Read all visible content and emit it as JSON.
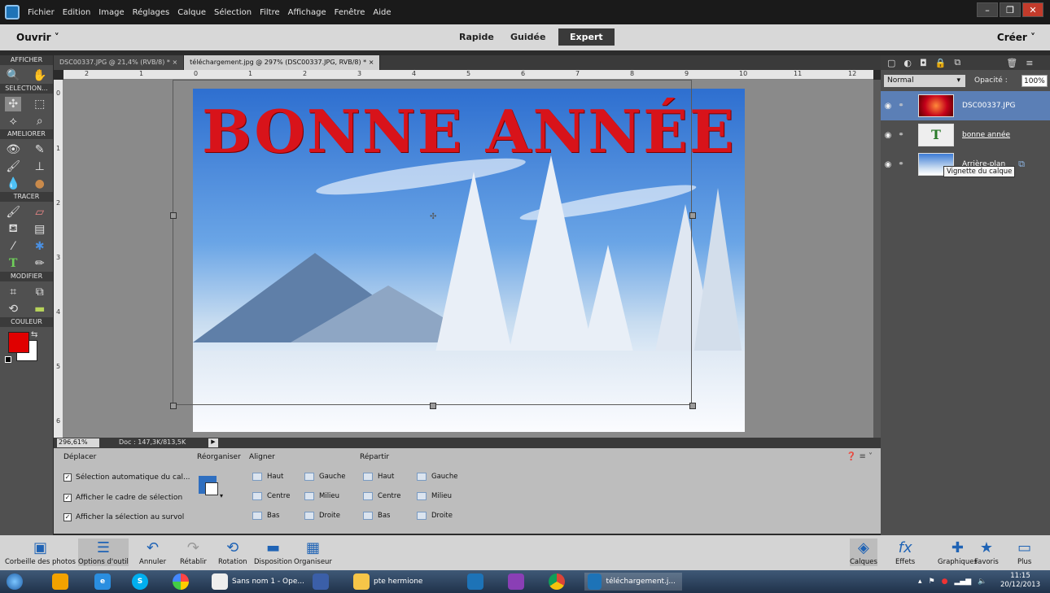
{
  "menubar": {
    "items": [
      "Fichier",
      "Edition",
      "Image",
      "Réglages",
      "Calque",
      "Sélection",
      "Filtre",
      "Affichage",
      "Fenêtre",
      "Aide"
    ],
    "window_buttons": [
      "–",
      "❐",
      "✕"
    ]
  },
  "modebar": {
    "open_label": "Ouvrir",
    "modes": [
      "Rapide",
      "Guidée",
      "Expert"
    ],
    "active_mode": "Expert",
    "create_label": "Créer"
  },
  "toolbox": {
    "sections": [
      "AFFICHER",
      "SELECTION...",
      "AMELIORER",
      "TRACER",
      "MODIFIER",
      "COULEUR"
    ],
    "foreground_color": "#e00000",
    "background_color": "#ffffff"
  },
  "doc_tabs": [
    {
      "label": "DSC00337.JPG @ 21,4% (RVB/8) *"
    },
    {
      "label": "téléchargement.jpg @ 297% (DSC00337.JPG, RVB/8) *"
    }
  ],
  "ruler": {
    "h_marks": [
      "2",
      "1",
      "0",
      "1",
      "2",
      "3",
      "4",
      "5",
      "6",
      "7",
      "8",
      "9",
      "10",
      "11",
      "12"
    ],
    "v_marks": [
      "0",
      "1",
      "2",
      "3",
      "4",
      "5",
      "6"
    ]
  },
  "canvas": {
    "title_text": "BONNE ANNÉE"
  },
  "status": {
    "zoom": "296,61%",
    "doc_info": "Doc : 147,3K/813,5K"
  },
  "options": {
    "deplacer_label": "Déplacer",
    "checks": [
      "Sélection automatique du cal...",
      "Afficher le cadre de sélection",
      "Afficher la sélection au survol"
    ],
    "reorganiser_label": "Réorganiser",
    "aligner_label": "Aligner",
    "repartir_label": "Répartir",
    "align_col1": [
      "Haut",
      "Centre",
      "Bas"
    ],
    "align_col2": [
      "Gauche",
      "Milieu",
      "Droite"
    ],
    "repartir_col1": [
      "Haut",
      "Centre",
      "Bas"
    ],
    "repartir_col2": [
      "Gauche",
      "Milieu",
      "Droite"
    ]
  },
  "layers_panel": {
    "blend_mode": "Normal",
    "opacity_label": "Opacité :",
    "opacity_value": "100%",
    "layers": [
      {
        "name": "DSC00337.JPG"
      },
      {
        "name": "bonne année"
      },
      {
        "name": "Arrière-plan"
      }
    ],
    "tooltip": "Vignette du calque"
  },
  "bottom_bar": {
    "left": [
      "Corbeille des photos",
      "Options d'outil",
      "Annuler",
      "Rétablir",
      "Rotation",
      "Disposition",
      "Organiseur"
    ],
    "right": [
      "Calques",
      "Effets",
      "Graphiques",
      "Favoris",
      "Plus"
    ]
  },
  "taskbar": {
    "items": [
      "Sans nom 1 - Ope...",
      "pte hermione",
      "téléchargement.j..."
    ],
    "time": "11:15",
    "date": "20/12/2013"
  }
}
